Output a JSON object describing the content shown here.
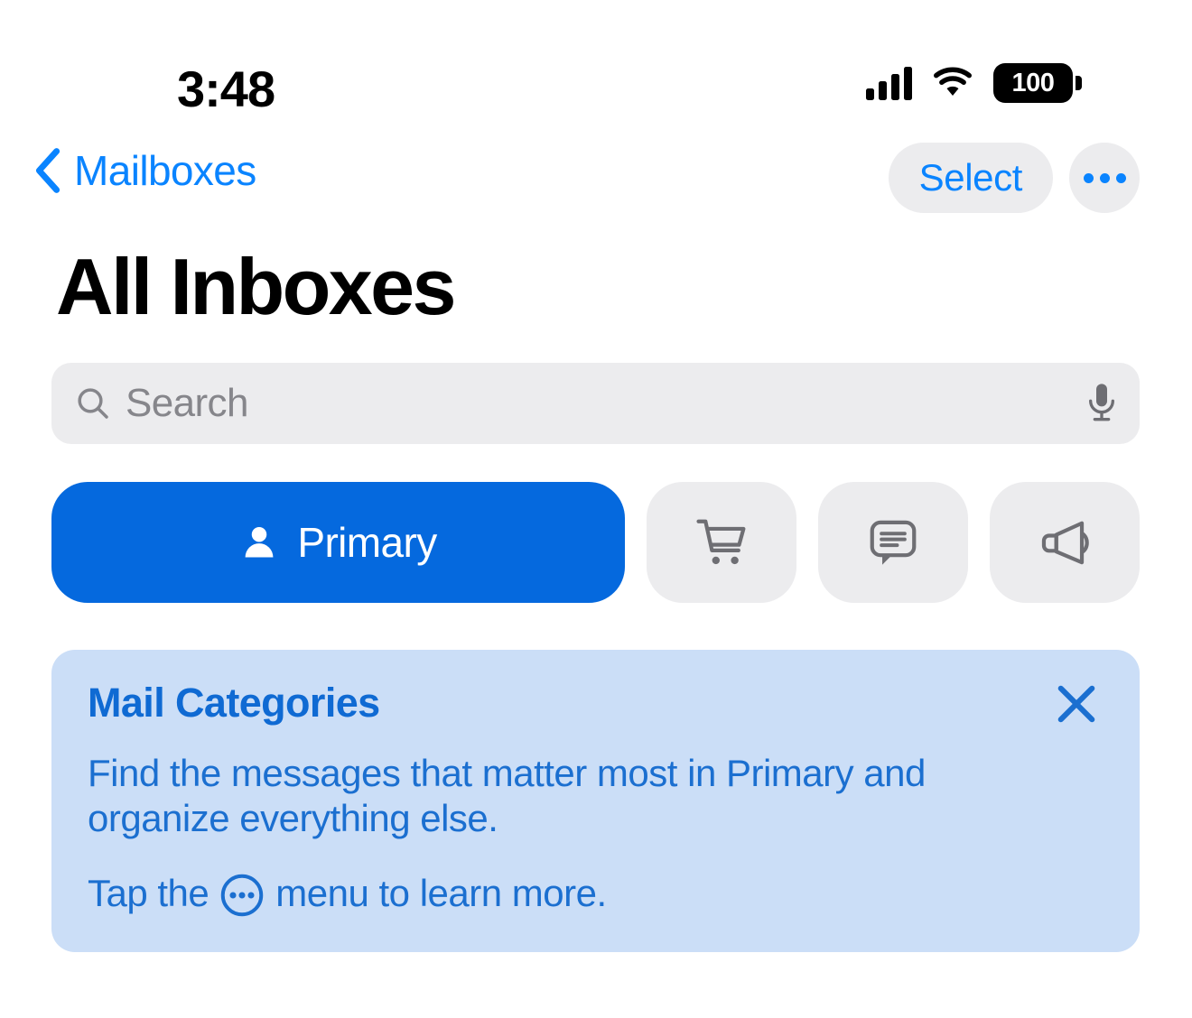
{
  "status_bar": {
    "time": "3:48",
    "cellular_icon": "cellular-bars-icon",
    "wifi_icon": "wifi-icon",
    "battery_level": "100",
    "battery_icon": "battery-full-icon"
  },
  "nav": {
    "back_icon": "chevron-left-icon",
    "back_label": "Mailboxes",
    "select_label": "Select",
    "more_icon": "ellipsis-icon"
  },
  "header": {
    "title": "All Inboxes"
  },
  "search": {
    "placeholder": "Search",
    "search_icon": "search-icon",
    "mic_icon": "microphone-icon"
  },
  "categories": [
    {
      "id": "primary",
      "label": "Primary",
      "icon": "person-icon",
      "selected": true
    },
    {
      "id": "transactions",
      "label": "",
      "icon": "shopping-cart-icon",
      "selected": false
    },
    {
      "id": "updates",
      "label": "",
      "icon": "speech-bubble-icon",
      "selected": false
    },
    {
      "id": "promotions",
      "label": "",
      "icon": "megaphone-icon",
      "selected": false
    }
  ],
  "banner": {
    "title": "Mail Categories",
    "body": "Find the messages that matter most in Primary and organize everything else.",
    "tap_prefix": "Tap the",
    "tap_icon": "circled-ellipsis-icon",
    "tap_suffix": "menu to learn more.",
    "close_icon": "close-icon"
  },
  "colors": {
    "accent_blue": "#0a84ff",
    "primary_button": "#0569de",
    "banner_background": "#cbdef7",
    "banner_text": "#1b6fd0",
    "banner_title": "#0f6ad3",
    "chip_background": "#ececee",
    "placeholder_gray": "#86868b",
    "page_background": "#ffffff"
  }
}
